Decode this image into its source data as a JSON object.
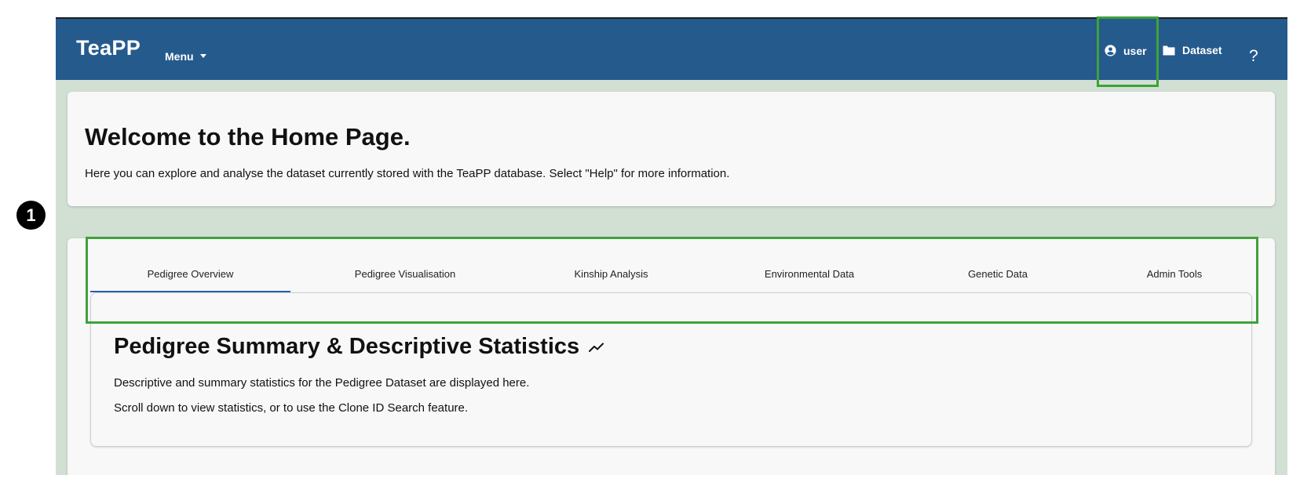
{
  "app": {
    "brand": "TeaPP",
    "menu_label": "Menu",
    "user_label": "user",
    "dataset_label": "Dataset",
    "help_label": "?"
  },
  "welcome": {
    "title": "Welcome to the Home Page.",
    "text": "Here you can explore and analyse the dataset currently stored with the TeaPP database. Select \"Help\" for more information."
  },
  "tabs": [
    {
      "label": "Pedigree Overview",
      "active": true
    },
    {
      "label": "Pedigree Visualisation",
      "active": false
    },
    {
      "label": "Kinship Analysis",
      "active": false
    },
    {
      "label": "Environmental Data",
      "active": false
    },
    {
      "label": "Genetic Data",
      "active": false
    },
    {
      "label": "Admin Tools",
      "active": false
    }
  ],
  "section": {
    "title": "Pedigree Summary & Descriptive Statistics",
    "line1": "Descriptive and summary statistics for the Pedigree Dataset are displayed here.",
    "line2": "Scroll down to view statistics, or to use the Clone ID Search feature."
  },
  "annotation": {
    "step_number": "1",
    "highlight_color": "#3ea23a"
  },
  "colors": {
    "header": "#255a8d",
    "page_background": "#d2e0d4",
    "tab_indicator": "#2b5fb0"
  },
  "icons": {
    "user": "account-circle-icon",
    "dataset": "folder-icon",
    "section_title": "trending-up-icon",
    "menu": "caret-down-icon"
  }
}
